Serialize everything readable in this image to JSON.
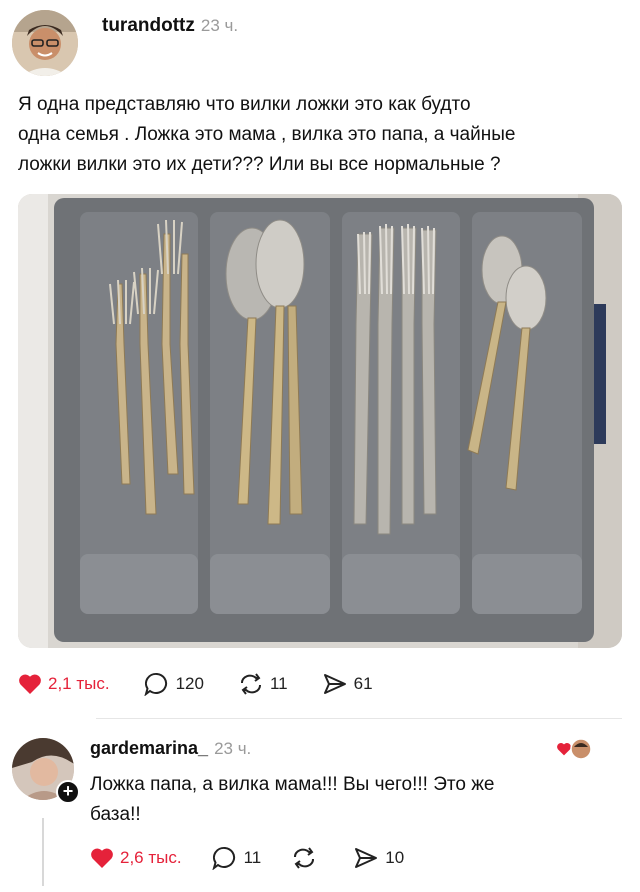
{
  "post": {
    "username": "turandottz",
    "time": "23 ч.",
    "lines": [
      "Я одна представляю что вилки ложки это как будто",
      "одна семья . Ложка это мама , вилка это папа, а чайные",
      "ложки вилки это их дети??? Или вы все нормальные ?"
    ],
    "stats": {
      "likes": "2,1 тыс.",
      "comments": "120",
      "reposts": "11",
      "shares": "61"
    }
  },
  "reply": {
    "username": "gardemarina_",
    "time": "23 ч.",
    "lines": [
      "Ложка папа, а вилка мама!!! Вы чего!!! Это же",
      "база!!"
    ],
    "stats": {
      "likes": "2,6 тыс.",
      "comments": "11",
      "shares": "10"
    }
  },
  "colors": {
    "like_red": "#e5223a",
    "tray_gray": "#6f7276",
    "muted_text": "#9a9a9a"
  },
  "icons": [
    "heart-icon",
    "comment-icon",
    "repost-icon",
    "share-icon",
    "plus-icon"
  ]
}
